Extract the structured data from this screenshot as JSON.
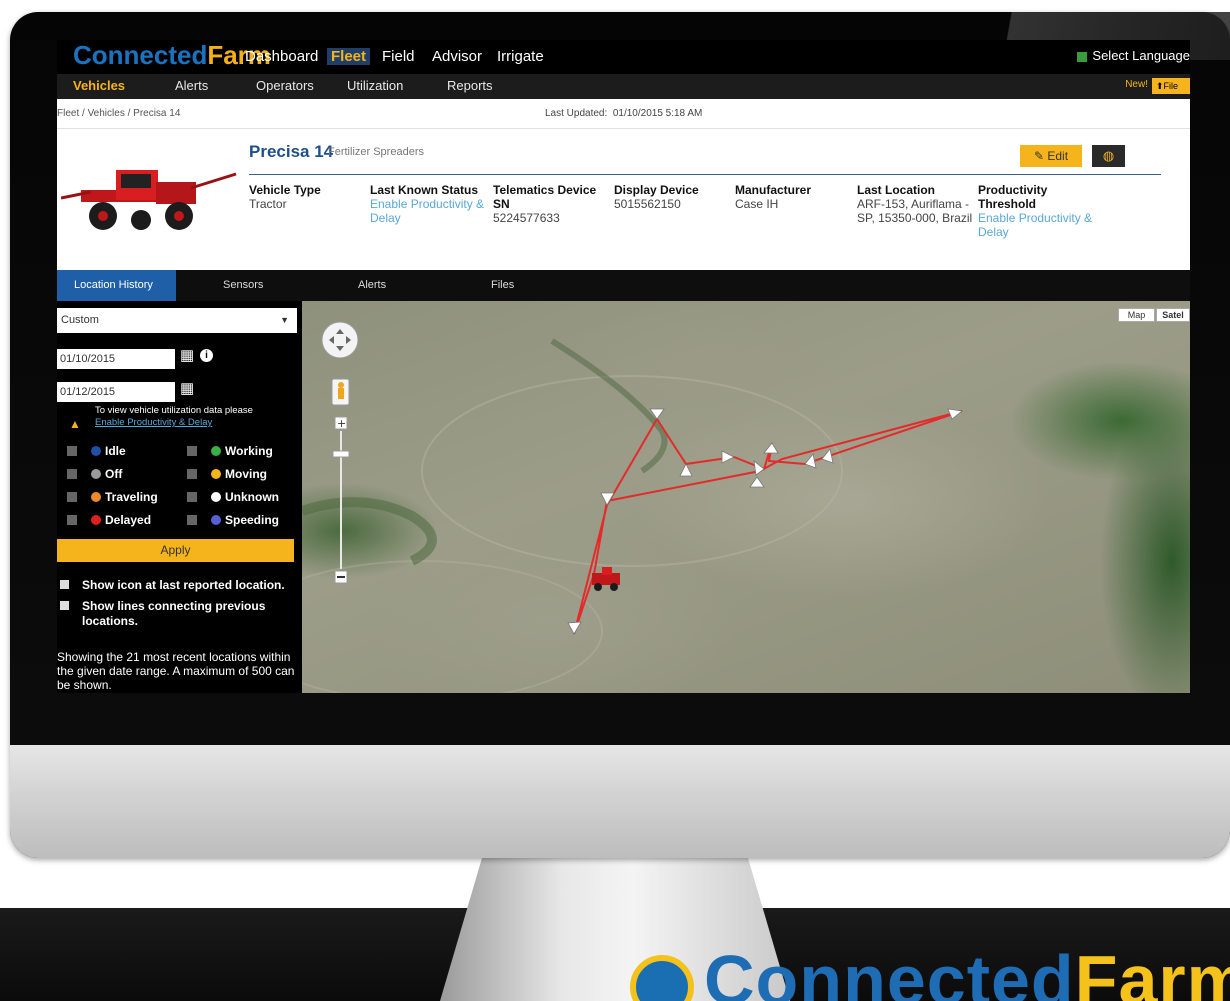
{
  "nav": {
    "logo_main": "Connected",
    "logo_accent": "Farm",
    "items": [
      "Dashboard",
      "Fleet",
      "Field",
      "Advisor",
      "Irrigate"
    ],
    "active": "Fleet",
    "language": "Select Language"
  },
  "subnav": {
    "items": [
      "Vehicles",
      "Alerts",
      "Operators",
      "Utilization",
      "Reports"
    ],
    "active": "Vehicles",
    "new_label": "New!",
    "file_button": "File"
  },
  "breadcrumb": "Fleet / Vehicles / Precisa 14",
  "last_updated_label": "Last Updated:",
  "last_updated_value": "01/10/2015 5:18 AM",
  "vehicle": {
    "name": "Precisa 14",
    "category": "Fertilizer Spreaders",
    "edit_label": "Edit",
    "fields": [
      {
        "label": "Vehicle Type",
        "value": "Tractor"
      },
      {
        "label": "Last Known Status",
        "link": "Enable Productivity & Delay"
      },
      {
        "label": "Telematics Device SN",
        "value": "5224577633"
      },
      {
        "label": "Display Device",
        "value": "5015562150"
      },
      {
        "label": "Manufacturer",
        "value": "Case IH"
      },
      {
        "label": "Last Location",
        "value": "ARF-153, Auriflama - SP, 15350-000, Brazil"
      },
      {
        "label": "Productivity Threshold",
        "link": "Enable Productivity & Delay"
      }
    ]
  },
  "tabs": [
    "Location History",
    "Sensors",
    "Alerts",
    "Files"
  ],
  "active_tab": "Location History",
  "panel": {
    "range_select": "Custom",
    "start_date": "01/10/2015",
    "end_date": "01/12/2015",
    "warning_text": "To view vehicle utilization data please",
    "warning_link": "Enable Productivity & Delay",
    "statuses": [
      {
        "label": "Idle",
        "color": "#1f4fa8"
      },
      {
        "label": "Working",
        "color": "#3cb043"
      },
      {
        "label": "Off",
        "color": "#9a9a9a"
      },
      {
        "label": "Moving",
        "color": "#f5b41b"
      },
      {
        "label": "Traveling",
        "color": "#f08a24"
      },
      {
        "label": "Unknown",
        "color": "#ffffff"
      },
      {
        "label": "Delayed",
        "color": "#e02020"
      },
      {
        "label": "Speeding",
        "color": "#5a5fd6"
      }
    ],
    "apply_label": "Apply",
    "option_icon": "Show icon at last reported location.",
    "option_lines": "Show lines connecting previous locations.",
    "summary": "Showing the 21 most recent locations within the given date range. A maximum of 500 can be shown."
  },
  "map": {
    "map_button": "Map",
    "satellite_button": "Satel"
  },
  "colors": {
    "accent": "#f5b41b",
    "brand_blue": "#1f4e8c",
    "link": "#59a7d9",
    "route": "#e32b2b"
  },
  "footer_logo": {
    "main": "Connected",
    "accent": "Farm"
  }
}
